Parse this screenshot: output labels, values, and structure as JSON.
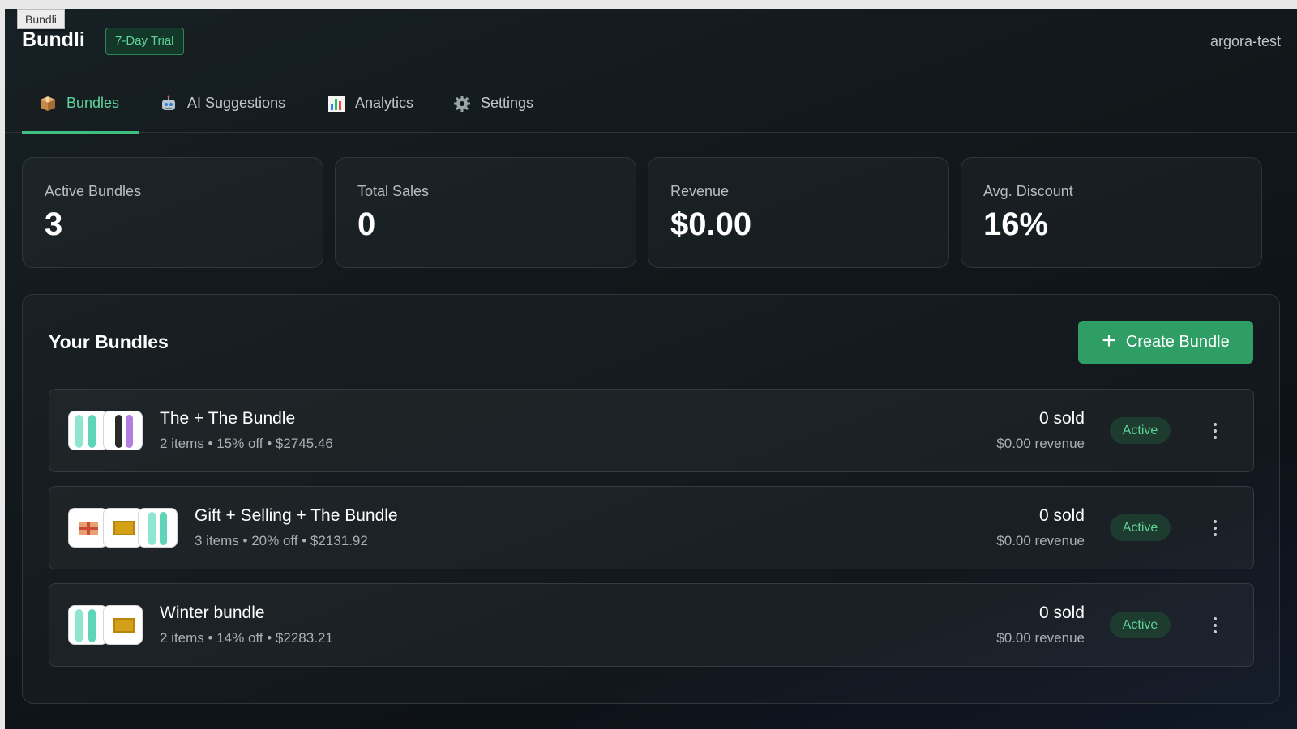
{
  "tooltip": "Bundli",
  "header": {
    "brand": "Bundli",
    "trial_badge": "7-Day Trial",
    "user": "argora-test"
  },
  "tabs": [
    {
      "icon": "package-icon",
      "label": "Bundles",
      "active": true
    },
    {
      "icon": "robot-icon",
      "label": "AI Suggestions",
      "active": false
    },
    {
      "icon": "bar-chart-icon",
      "label": "Analytics",
      "active": false
    },
    {
      "icon": "gear-icon",
      "label": "Settings",
      "active": false
    }
  ],
  "stats": [
    {
      "label": "Active Bundles",
      "value": "3"
    },
    {
      "label": "Total Sales",
      "value": "0"
    },
    {
      "label": "Revenue",
      "value": "$0.00"
    },
    {
      "label": "Avg. Discount",
      "value": "16%"
    }
  ],
  "bundles_panel": {
    "title": "Your Bundles",
    "create_label": "Create Bundle",
    "rows": [
      {
        "name": "The + The Bundle",
        "meta": "2 items • 15% off • $2745.46",
        "sold": "0 sold",
        "revenue": "$0.00 revenue",
        "status": "Active"
      },
      {
        "name": "Gift + Selling + The Bundle",
        "meta": "3 items • 20% off • $2131.92",
        "sold": "0 sold",
        "revenue": "$0.00 revenue",
        "status": "Active"
      },
      {
        "name": "Winter bundle",
        "meta": "2 items • 14% off • $2283.21",
        "sold": "0 sold",
        "revenue": "$0.00 revenue",
        "status": "Active"
      }
    ]
  },
  "colors": {
    "accent": "#5fd39a",
    "button": "#2e9e64",
    "background": "#11171a"
  }
}
